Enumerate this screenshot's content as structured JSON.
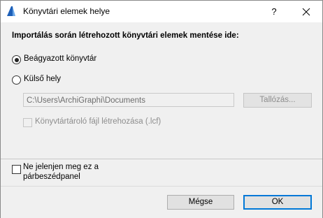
{
  "window": {
    "title": "Könyvtári elemek helye",
    "help_label": "?",
    "icon": "archicad-icon"
  },
  "main": {
    "heading": "Importálás során létrehozott könyvtári elemek mentése ide:",
    "options": [
      {
        "label": "Beágyazott könyvtár",
        "selected": true
      },
      {
        "label": "Külső hely",
        "selected": false
      }
    ],
    "path_value": "C:\\Users\\ArchiGraphi\\Documents",
    "browse_label": "Tallózás...",
    "container_checkbox_label": "Könyvtártároló fájl létrehozása (.lcf)",
    "container_checkbox_checked": false
  },
  "footer": {
    "dont_show_line1": "Ne jelenjen meg ez a",
    "dont_show_line2": "párbeszédpanel",
    "dont_show_checked": false,
    "cancel_label": "Mégse",
    "ok_label": "OK"
  },
  "colors": {
    "accent": "#0078d7",
    "dialog_bg": "#f0f0f0",
    "disabled_text": "#8d8d8d"
  }
}
